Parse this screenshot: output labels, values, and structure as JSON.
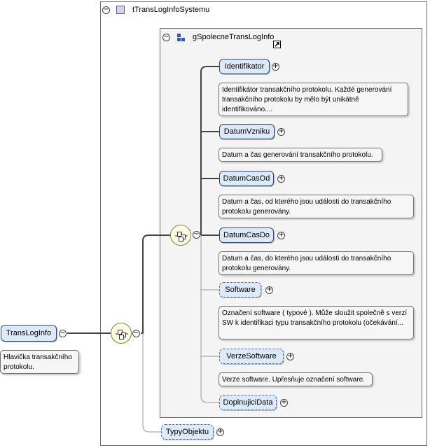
{
  "complex_type": {
    "name": "tTransLogInfoSystemu",
    "collapse_symbol": "⊖"
  },
  "group": {
    "name": "gSpolecneTransLogInfo",
    "collapse_symbol": "⊖"
  },
  "root": {
    "name": "TransLogInfo",
    "doc": "Hlavička transakčního protokolu."
  },
  "children": [
    {
      "name": "Identifikator",
      "doc": "Identifikátor transakčního protokolu. Každé generování transakčního protokolu by mělo být unikátně identifikováno...."
    },
    {
      "name": "DatumVzniku",
      "doc": "Datum a čas generování transakčního protokolu."
    },
    {
      "name": "DatumCasOd",
      "doc": "Datum a čas, od kterého jsou události do transakčního protokolu generovány."
    },
    {
      "name": "DatumCasDo",
      "doc": "Datum a čas, do kterého jsou události do transakčního protokolu generovány."
    },
    {
      "name": "Software",
      "doc": "Označení software ( typové ). Může sloužit společně s verzí SW k identifikaci typu transakčního protokolu (očekávání..."
    },
    {
      "name": "VerzeSoftware",
      "doc": "Verze software. Upřesňuje označení software."
    },
    {
      "name": "DoplnujiciData",
      "doc": ""
    }
  ],
  "typy_objektu": {
    "name": "TypyObjektu"
  },
  "symbols": {
    "expand": "+",
    "collapse": "−"
  },
  "colors": {
    "element_fill": "#dde8f8",
    "element_border": "#33447a",
    "frame_border": "#6f6f6f",
    "group_frame_fill": "#f4f4f4",
    "connector": "#555555",
    "sequence_fill": "#fffde4"
  }
}
